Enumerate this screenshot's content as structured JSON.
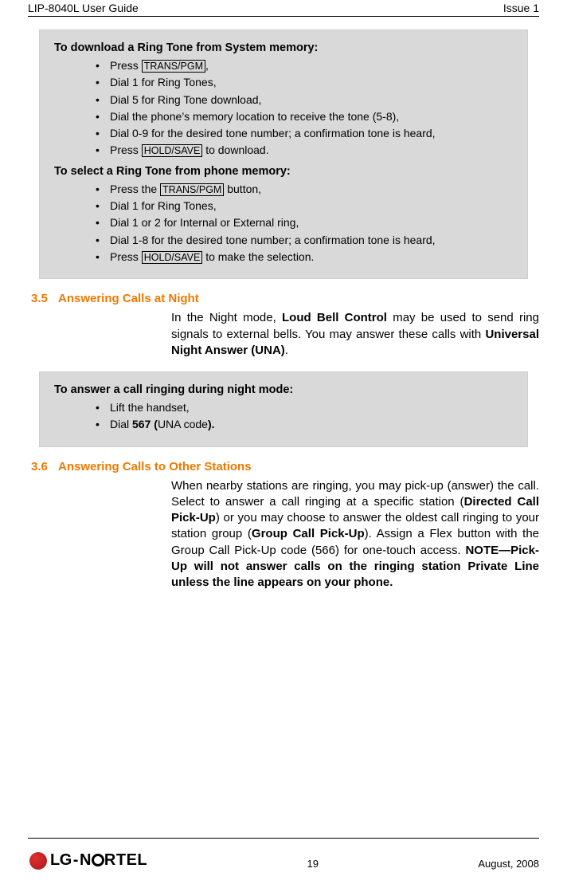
{
  "header": {
    "left": "LIP-8040L User Guide",
    "right": "Issue 1"
  },
  "box1": {
    "heading1": "To download a Ring Tone from System memory:",
    "steps1": {
      "s1_pre": "Press ",
      "s1_key": "TRANS/PGM",
      "s1_post": ",",
      "s2": "Dial 1 for Ring Tones,",
      "s3": "Dial 5 for Ring Tone download,",
      "s4": "Dial the phone’s memory location to receive the tone (5-8),",
      "s5": "Dial 0-9 for the desired tone number; a confirmation tone is heard,",
      "s6_pre": "Press ",
      "s6_key": "HOLD/SAVE",
      "s6_post": " to download."
    },
    "heading2": "To select a Ring Tone from phone memory:",
    "steps2": {
      "s1_pre": "Press the ",
      "s1_key": "TRANS/PGM",
      "s1_post": " button,",
      "s2": "Dial 1 for Ring Tones,",
      "s3": "Dial 1 or 2 for Internal or External ring,",
      "s4": "Dial 1-8 for the desired tone number; a confirmation tone is heard,",
      "s5_pre": "Press ",
      "s5_key": "HOLD/SAVE",
      "s5_post": " to make the selection."
    }
  },
  "section35": {
    "num": "3.5",
    "title": "Answering Calls at Night",
    "body_pre": "In the Night mode, ",
    "body_bold1": "Loud Bell Control",
    "body_mid": " may be used to send ring signals to external bells.  You may answer these calls with ",
    "body_bold2": "Universal Night Answer (UNA)",
    "body_post": "."
  },
  "box2": {
    "heading": "To answer a call ringing during night mode:",
    "s1": "Lift the handset,",
    "s2_pre": "Dial ",
    "s2_bold": "567 (",
    "s2_mid": "UNA code",
    "s2_post_bold": ").",
    "s2_end": ""
  },
  "section36": {
    "num": "3.6",
    "title": "Answering Calls to Other Stations",
    "p_1": "When nearby stations are ringing, you may pick-up (answer) the call.  Select to answer a call ringing at a specific station (",
    "p_b1": "Directed Call Pick-Up",
    "p_2": ") or you may choose to answer the oldest call ringing to your station group (",
    "p_b2": "Group Call Pick-Up",
    "p_3": ").  Assign a Flex button with the Group Call Pick-Up code (566) for one-touch access. ",
    "p_b3": "NOTE—Pick-Up will not answer calls on the ringing station Private Line unless the line appears on your phone."
  },
  "footer": {
    "logo_lg": "LG",
    "logo_n": "N",
    "logo_rtel": "RTEL",
    "page_num": "19",
    "date": "August, 2008"
  }
}
